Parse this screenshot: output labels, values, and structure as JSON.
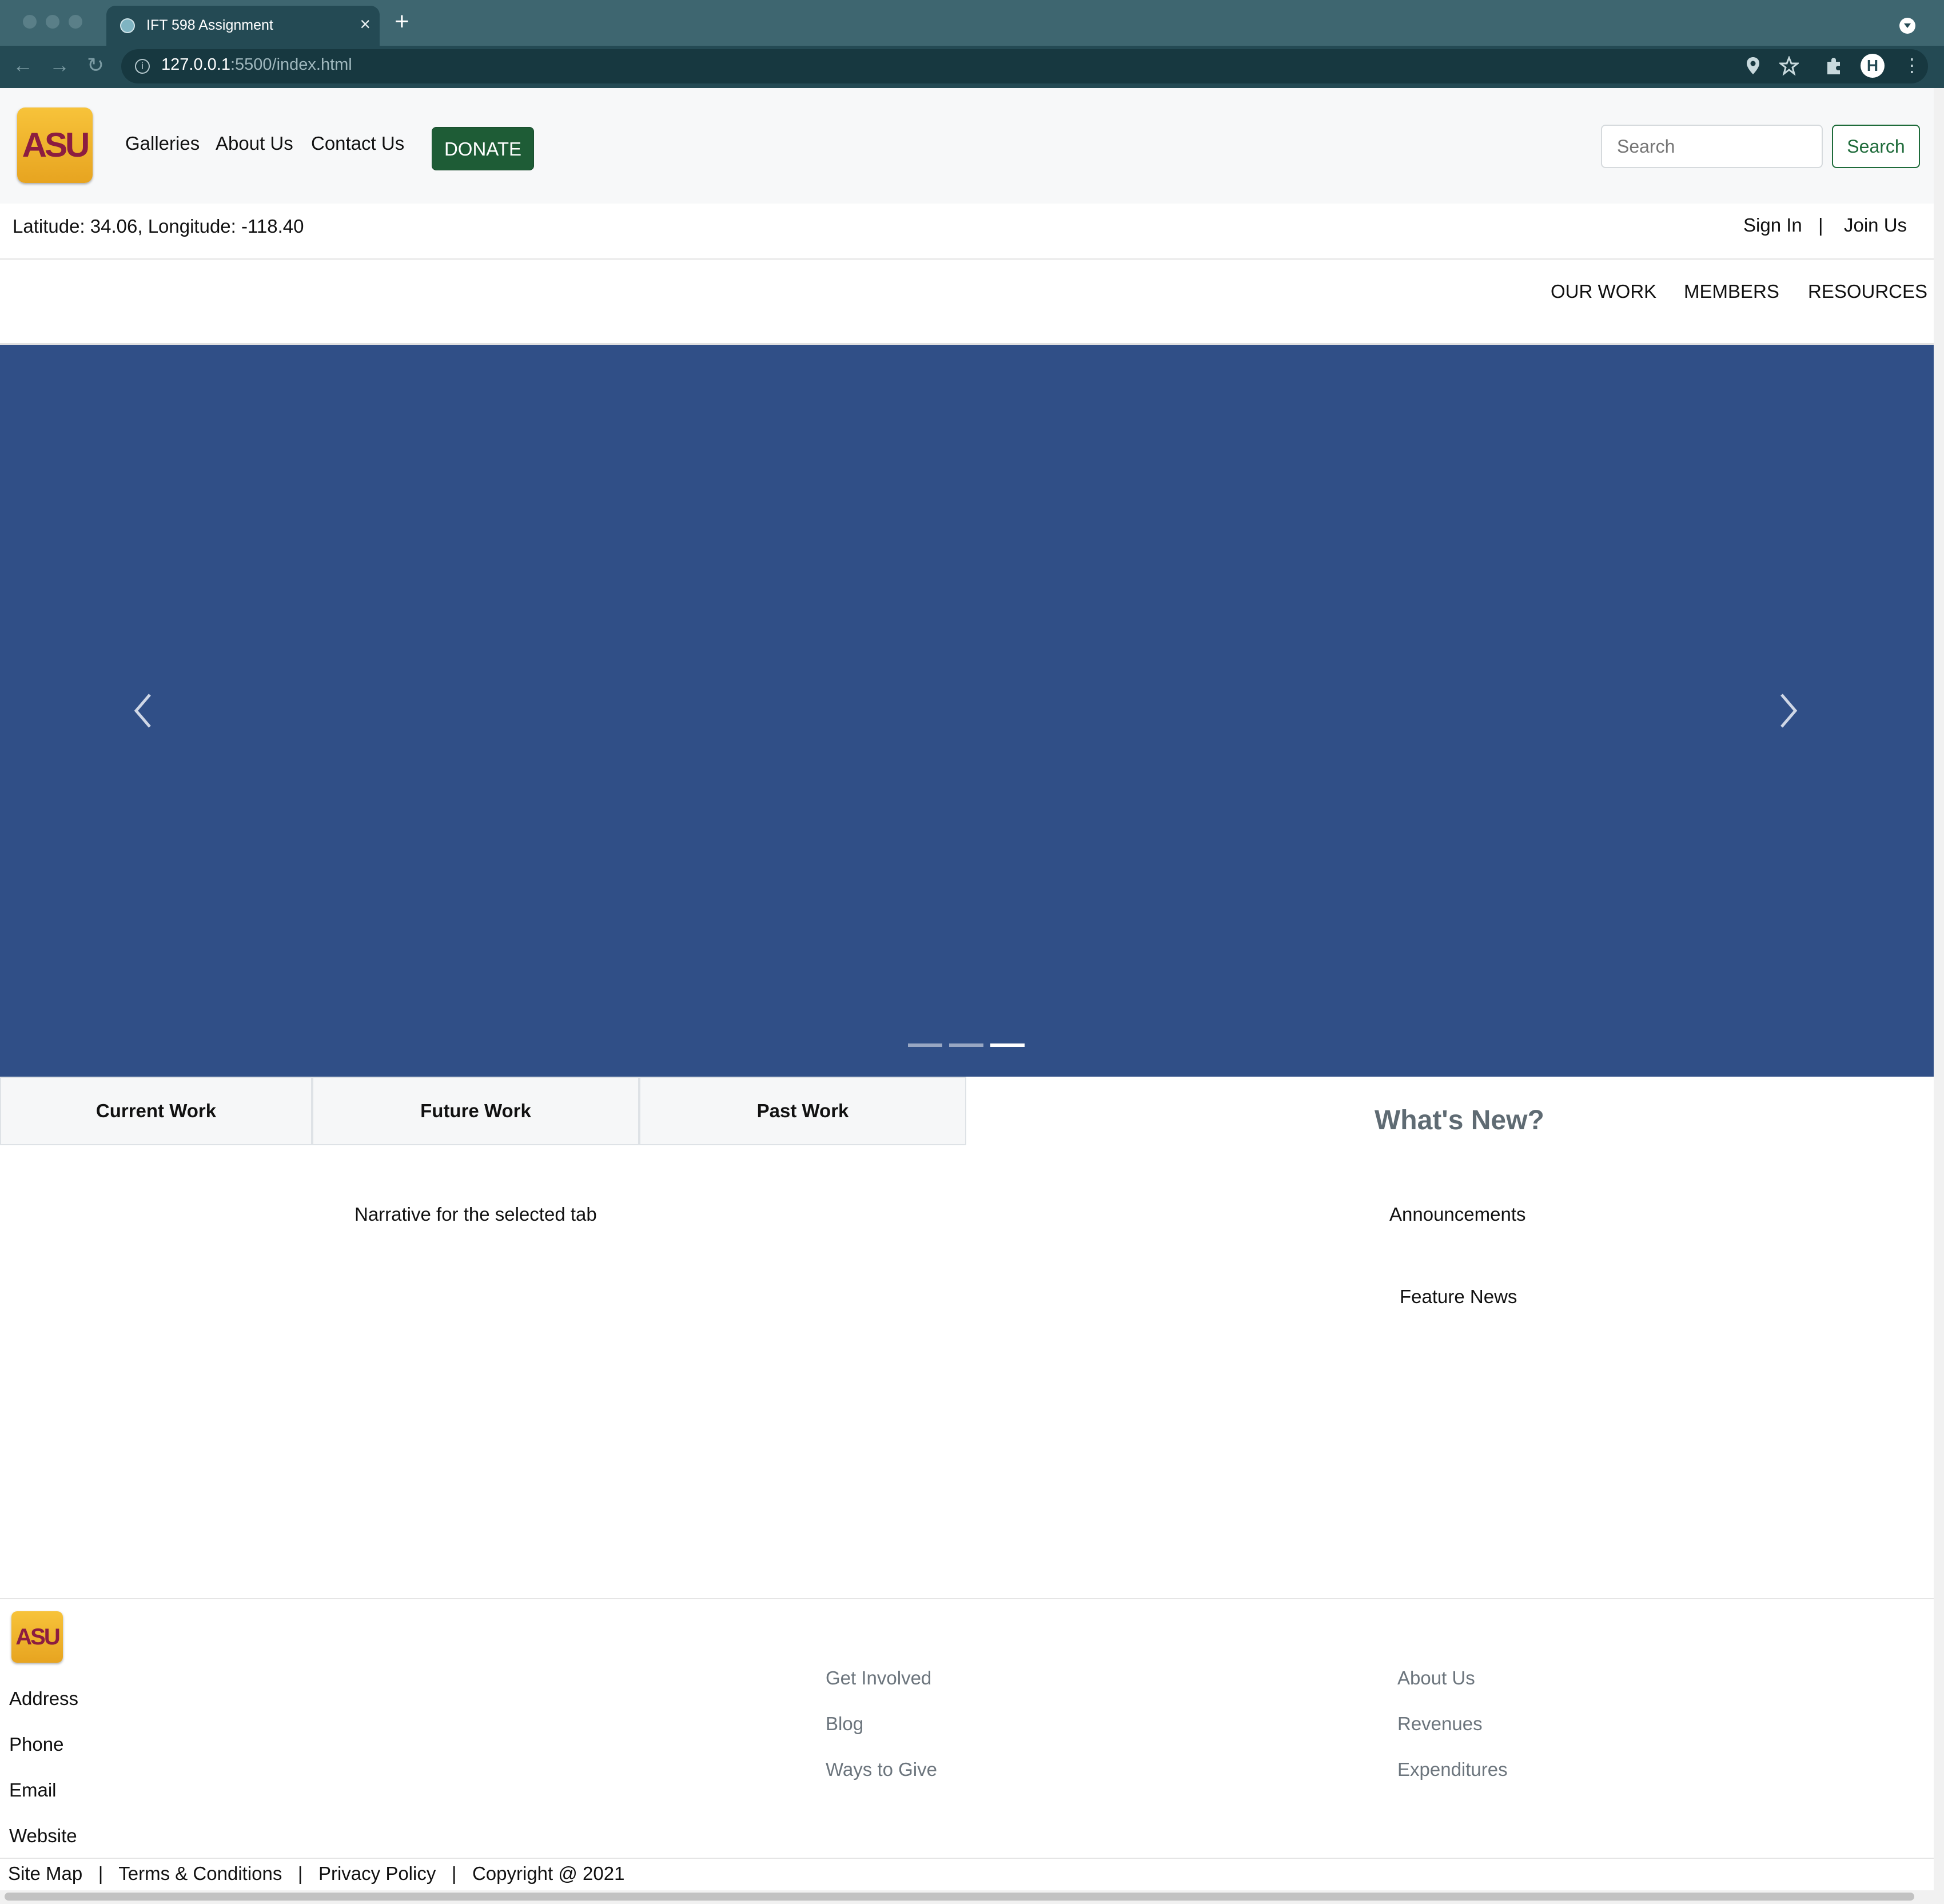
{
  "browser": {
    "tab_title": "IFT 598 Assignment",
    "tab_close": "×",
    "new_tab": "+",
    "url_host": "127.0.0.1",
    "url_rest": ":5500/index.html",
    "avatar_letter": "H"
  },
  "header": {
    "logo_text": "ASU",
    "nav": [
      "Galleries",
      "About Us",
      "Contact Us"
    ],
    "donate_label": "DONATE",
    "search_placeholder": "Search",
    "search_button": "Search"
  },
  "info_bar": {
    "location": "Latitude: 34.06, Longitude: -118.40",
    "sign_in": "Sign In",
    "separator": "|",
    "join_us": "Join Us"
  },
  "secondary_nav": [
    "OUR WORK",
    "MEMBERS",
    "RESOURCES"
  ],
  "carousel": {
    "background": "#304f87",
    "slide_count": 3,
    "active_slide": 3
  },
  "tabs": {
    "labels": [
      "Current Work",
      "Future Work",
      "Past Work"
    ],
    "narrative": "Narrative for the selected tab"
  },
  "whats_new": {
    "heading": "What's New?",
    "items": [
      "Announcements",
      "Feature News"
    ]
  },
  "footer": {
    "logo_text": "ASU",
    "contact": [
      "Address",
      "Phone",
      "Email",
      "Website"
    ],
    "col2": [
      "Get Involved",
      "Blog",
      "Ways to Give"
    ],
    "col3": [
      "About Us",
      "Revenues",
      "Expenditures"
    ],
    "legal": [
      "Site Map",
      "Terms & Conditions",
      "Privacy Policy",
      "Copyright @ 2021"
    ],
    "legal_separator": "|"
  },
  "colors": {
    "brand_maroon": "#8c1d40",
    "brand_gold": "#f7c33a",
    "donate_green": "#1e5c36",
    "carousel_blue": "#304f87"
  }
}
